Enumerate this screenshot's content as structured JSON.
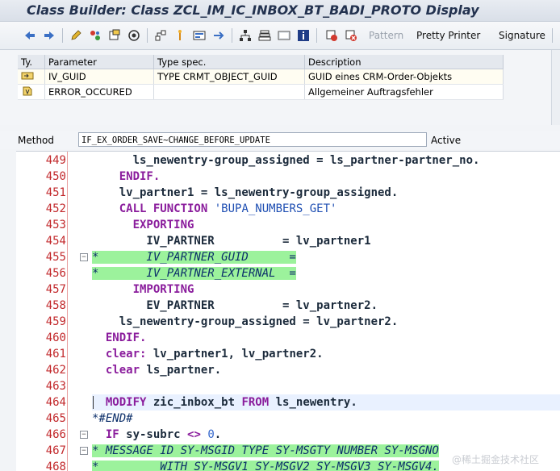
{
  "window": {
    "title": "Class Builder: Class ZCL_IM_IC_INBOX_BT_BADI_PROTO Display"
  },
  "toolbar": {
    "pattern_label": "Pattern",
    "pretty_printer_label": "Pretty Printer",
    "signature_label": "Signature"
  },
  "params": {
    "headers": [
      "Ty.",
      "Parameter",
      "Type spec.",
      "Description"
    ],
    "rows": [
      {
        "param": "IV_GUID",
        "type": "TYPE CRMT_OBJECT_GUID",
        "desc": "GUID eines CRM-Order-Objekts"
      },
      {
        "param": "ERROR_OCCURED",
        "type": "",
        "desc": "Allgemeiner Auftragsfehler"
      }
    ]
  },
  "method": {
    "label": "Method",
    "value": "IF_EX_ORDER_SAVE~CHANGE_BEFORE_UPDATE",
    "status": "Active"
  },
  "code": {
    "lines": [
      {
        "n": "449",
        "parts": [
          {
            "t": "      ls_newentry-group_assigned = ls_partner-partner_no."
          }
        ]
      },
      {
        "n": "450",
        "parts": [
          {
            "t": "    "
          },
          {
            "t": "ENDIF.",
            "c": "kw"
          }
        ]
      },
      {
        "n": "451",
        "parts": [
          {
            "t": "    lv_partner1 = ls_newentry-group_assigned."
          }
        ]
      },
      {
        "n": "452",
        "parts": [
          {
            "t": "    "
          },
          {
            "t": "CALL FUNCTION",
            "c": "kw"
          },
          {
            "t": " "
          },
          {
            "t": "'BUPA_NUMBERS_GET'",
            "c": "str"
          }
        ]
      },
      {
        "n": "453",
        "parts": [
          {
            "t": "      "
          },
          {
            "t": "EXPORTING",
            "c": "kw"
          }
        ]
      },
      {
        "n": "454",
        "parts": [
          {
            "t": "        IV_PARTNER          = lv_partner1"
          }
        ]
      },
      {
        "n": "455",
        "comment": true,
        "fold": true,
        "parts": [
          {
            "t": "*       IV_PARTNER_GUID      =",
            "c": "green"
          }
        ]
      },
      {
        "n": "456",
        "comment": true,
        "parts": [
          {
            "t": "*       IV_PARTNER_EXTERNAL  =",
            "c": "green"
          }
        ]
      },
      {
        "n": "457",
        "parts": [
          {
            "t": "      "
          },
          {
            "t": "IMPORTING",
            "c": "kw"
          }
        ]
      },
      {
        "n": "458",
        "parts": [
          {
            "t": "        EV_PARTNER          = lv_partner2."
          }
        ]
      },
      {
        "n": "459",
        "parts": [
          {
            "t": "    ls_newentry-group_assigned = lv_partner2."
          }
        ]
      },
      {
        "n": "460",
        "parts": [
          {
            "t": "  "
          },
          {
            "t": "ENDIF.",
            "c": "kw"
          }
        ]
      },
      {
        "n": "461",
        "parts": [
          {
            "t": "  "
          },
          {
            "t": "clear:",
            "c": "kw"
          },
          {
            "t": " lv_partner1, lv_partner2."
          }
        ]
      },
      {
        "n": "462",
        "parts": [
          {
            "t": "  "
          },
          {
            "t": "clear",
            "c": "kw"
          },
          {
            "t": " ls_partner."
          }
        ]
      },
      {
        "n": "463",
        "parts": [
          {
            "t": ""
          }
        ]
      },
      {
        "n": "464",
        "current": true,
        "parts": [
          {
            "t": "  "
          },
          {
            "t": "MODIFY",
            "c": "kw"
          },
          {
            "t": " zic_inbox_bt "
          },
          {
            "t": "FROM",
            "c": "kw"
          },
          {
            "t": " ls_newentry."
          }
        ]
      },
      {
        "n": "465",
        "comment": true,
        "parts": [
          {
            "t": "*#END#"
          }
        ]
      },
      {
        "n": "466",
        "fold": true,
        "parts": [
          {
            "t": "  "
          },
          {
            "t": "IF",
            "c": "kw"
          },
          {
            "t": " sy-subrc "
          },
          {
            "t": "<>",
            "c": "kw"
          },
          {
            "t": " "
          },
          {
            "t": "0",
            "c": "num"
          },
          {
            "t": "."
          }
        ]
      },
      {
        "n": "467",
        "comment": true,
        "fold": true,
        "parts": [
          {
            "t": "* MESSAGE ID SY-MSGID TYPE SY-MSGTY NUMBER SY-MSGNO",
            "c": "green"
          }
        ]
      },
      {
        "n": "468",
        "comment": true,
        "parts": [
          {
            "t": "*         WITH SY-MSGV1 SY-MSGV2 SY-MSGV3 SY-MSGV4.",
            "c": "green"
          }
        ]
      }
    ]
  },
  "watermark": "@稀土掘金技术社区",
  "colors": {
    "line_number": "#c2282b",
    "keyword": "#8a1c9c",
    "comment_highlight": "#9cf29c",
    "string": "#1f4fb3"
  }
}
